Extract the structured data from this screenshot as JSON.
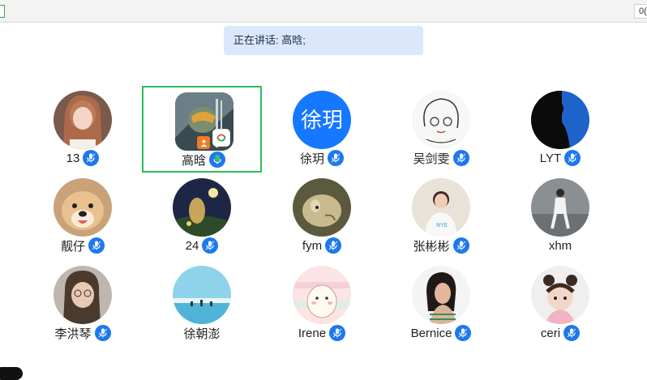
{
  "speaking_text": "正在讲话: 高晗;",
  "topbar_right_text": "0(",
  "participants": [
    {
      "name": "13",
      "avatar": "photo-girl"
    },
    {
      "name": "高晗",
      "avatar": "game-helmet",
      "active": true,
      "badges": [
        "host-badge",
        "share-badge"
      ]
    },
    {
      "name": "徐玥",
      "avatar": "text",
      "avatar_text": "徐玥"
    },
    {
      "name": "吴剑雯",
      "avatar": "sketch-girl"
    },
    {
      "name": "LYT",
      "avatar": "silhouette"
    },
    {
      "name": "靓仔",
      "avatar": "dog"
    },
    {
      "name": "24",
      "avatar": "night-anime"
    },
    {
      "name": "fym",
      "avatar": "cartoon-animal"
    },
    {
      "name": "张彬彬",
      "avatar": "photo-girl-2"
    },
    {
      "name": "xhm",
      "avatar": "street-photo"
    },
    {
      "name": "李洪琴",
      "avatar": "photo-girl-3"
    },
    {
      "name": "徐朝澎",
      "avatar": "sea-sky"
    },
    {
      "name": "Irene",
      "avatar": "pastel-cartoon"
    },
    {
      "name": "Bernice",
      "avatar": "photo-woman"
    },
    {
      "name": "ceri",
      "avatar": "baby"
    }
  ],
  "colors": {
    "accent": "#1d78f0",
    "active_border": "#2ebd59",
    "speaking_bg": "#dbe8fb"
  }
}
